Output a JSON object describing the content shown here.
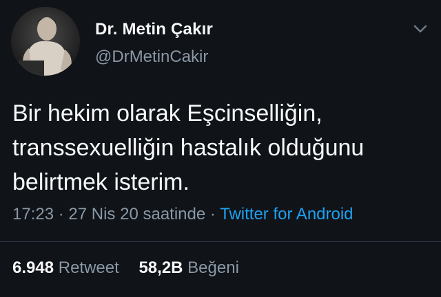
{
  "author": {
    "display_name": "Dr. Metin Çakır",
    "handle": "@DrMetinCakir"
  },
  "tweet": {
    "text": "Bir hekim olarak Eşcinselliğin,\ntranssexuelliğin hastalık olduğunu\nbelirtmek isterim."
  },
  "meta": {
    "time": "17:23",
    "separator1": "·",
    "date": "27 Nis 20 saatinde",
    "separator2": "·",
    "source": "Twitter for Android"
  },
  "stats": {
    "retweet_count": "6.948",
    "retweet_label": "Retweet",
    "like_count": "58,2B",
    "like_label": "Beğeni"
  },
  "icons": {
    "more": "chevron-down-icon"
  },
  "colors": {
    "background": "#101318",
    "link": "#1da1f2",
    "secondary_text": "#8a98a5"
  }
}
